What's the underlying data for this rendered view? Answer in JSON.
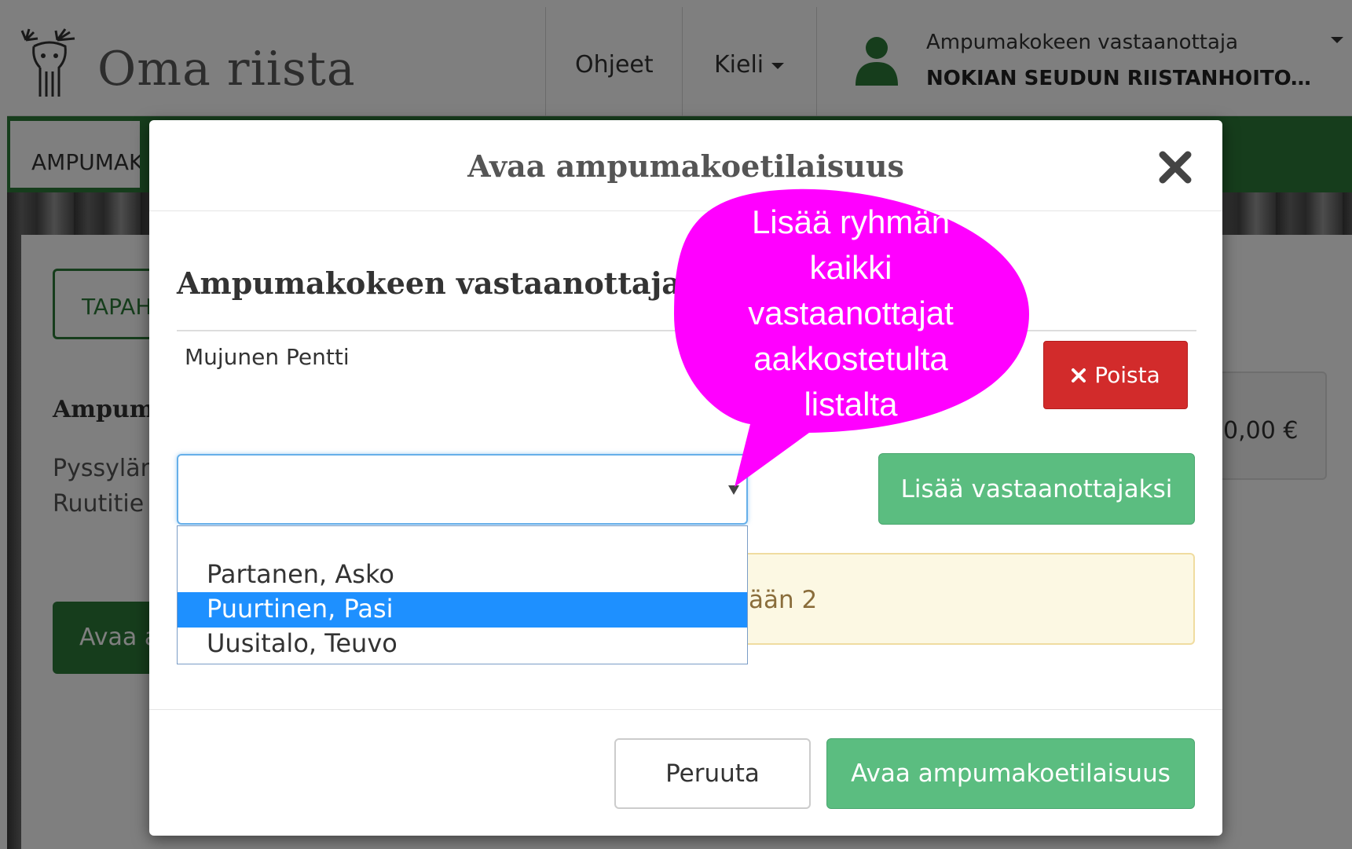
{
  "app": {
    "brand": "Oma riista",
    "nav": {
      "help_label": "Ohjeet",
      "language_label": "Kieli"
    },
    "user": {
      "role": "Ampumakokeen vastaanottaja",
      "organization": "NOKIAN SEUDUN RIISTANHOITOYHD..."
    },
    "subnav_tab": "AMPUMAK",
    "background": {
      "tab": "TAPAH",
      "section_title": "Ampuma",
      "place_line_1": "Pyssylän",
      "place_line_2": "Ruutitie",
      "fee": "0,00 €",
      "open_button": "Avaa a"
    }
  },
  "modal": {
    "title": "Avaa ampumakoetilaisuus",
    "receivers_title": "Ampumakokeen vastaanottajat",
    "receivers": [
      {
        "name": "Mujunen Pentti",
        "remove_label": "Poista"
      }
    ],
    "select": {
      "value": "",
      "options": [
        {
          "label": ""
        },
        {
          "label": "Partanen, Asko"
        },
        {
          "label": "Puurtinen, Pasi",
          "selected": true
        },
        {
          "label": "Uusitalo, Teuvo"
        }
      ]
    },
    "add_button": "Lisää vastaanottajaksi",
    "warning_text": "ään 2",
    "cancel_button": "Peruuta",
    "open_button": "Avaa ampumakoetilaisuus"
  },
  "callout": {
    "lines": [
      "Lisää ryhmän",
      "kaikki",
      "vastaanottajat",
      "aakkostetulta",
      "listalta"
    ],
    "color": "#ff00ff"
  },
  "colors": {
    "brand_green": "#2c7a39",
    "button_green": "#5bbd80",
    "danger_red": "#d22b2b",
    "select_highlight": "#1e90ff",
    "warning_bg": "#fcf8e3"
  },
  "icons": {
    "logo": "moose-logo-icon",
    "user": "user-icon",
    "close": "close-icon",
    "remove": "times-icon"
  }
}
